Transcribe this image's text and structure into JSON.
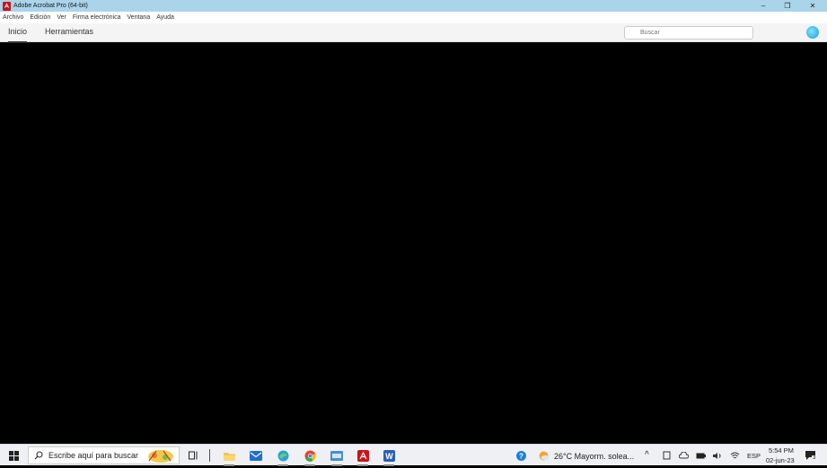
{
  "window": {
    "title": "Adobe Acrobat Pro (64-bit)",
    "controls": [
      "–",
      "❐",
      "✕"
    ]
  },
  "menu": {
    "items": [
      "Archivo",
      "Edición",
      "Ver",
      "Firma electrónica",
      "Ventana",
      "Ayuda"
    ]
  },
  "tabs": {
    "home": "Inicio",
    "tools": "Herramientas",
    "active": "Inicio"
  },
  "search": {
    "placeholder": "Buscar"
  },
  "taskbar": {
    "search_text": "Escribe aquí para buscar",
    "weather": "26°C  Mayorm. solea...",
    "language": "ESP",
    "time": "5:54 PM",
    "date": "02-jun-23",
    "notification_count": "3",
    "pinned_apps": [
      "task-view",
      "file-explorer",
      "mail",
      "edge",
      "chrome",
      "terminal",
      "acrobat",
      "word"
    ]
  },
  "colors": {
    "titlebar": "#aad4ea",
    "acrobat_red": "#c8141b",
    "canvas": "#000000"
  }
}
